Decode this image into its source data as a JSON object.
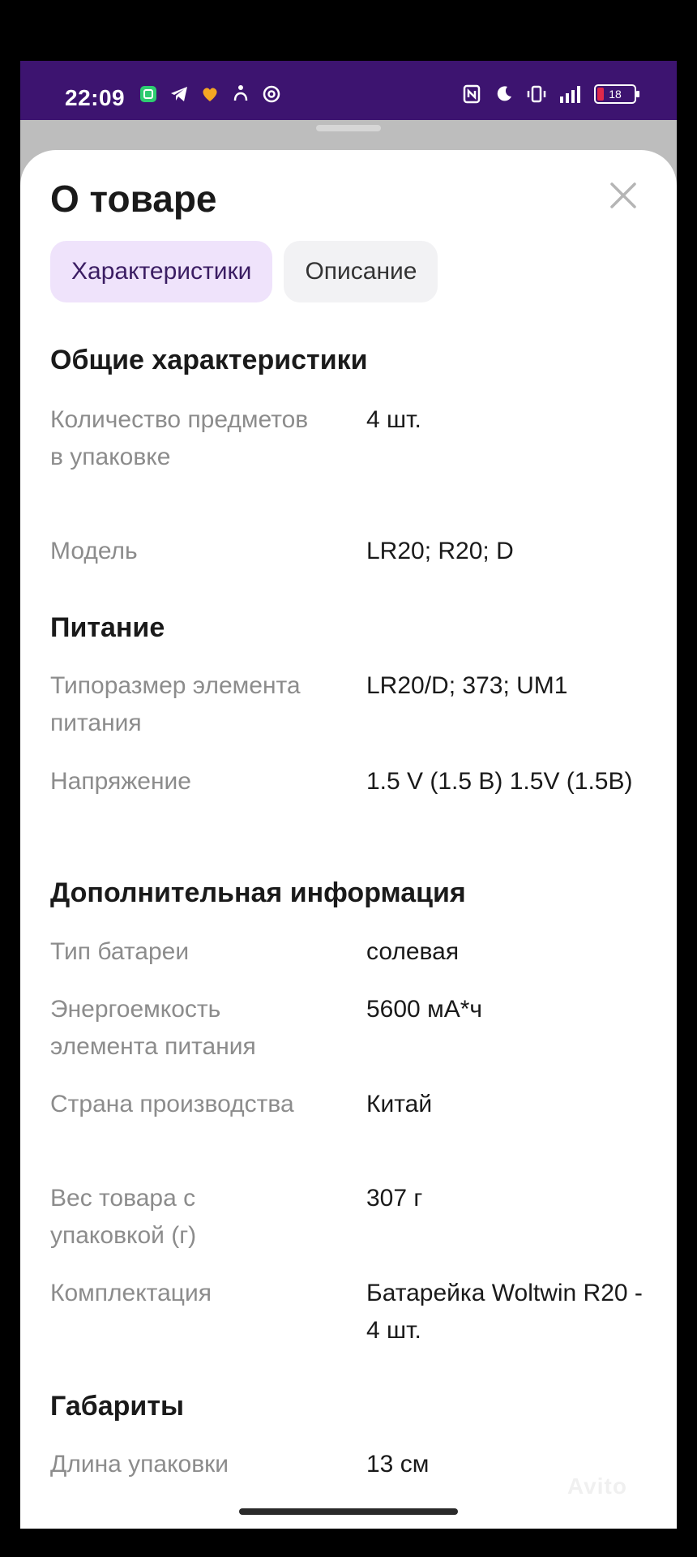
{
  "status_bar": {
    "time": "22:09",
    "battery": "18",
    "left_icons": [
      "notes-app-icon",
      "telegram-icon",
      "dating-app-icon",
      "accessibility-icon",
      "at-icon"
    ],
    "right_icons": [
      "nfc-icon",
      "moon-icon",
      "vibrate-icon",
      "signal-icon"
    ]
  },
  "sheet": {
    "title": "О товаре",
    "close_icon": "close-icon",
    "tabs": [
      {
        "label": "Характеристики",
        "active": true
      },
      {
        "label": "Описание",
        "active": false
      }
    ]
  },
  "sections": [
    {
      "title": "Общие характеристики",
      "rows": [
        {
          "label": "Количество предметов в упаковке",
          "value": "4 шт."
        },
        {
          "label": "Модель",
          "value": "LR20; R20; D"
        }
      ]
    },
    {
      "title": "Питание",
      "rows": [
        {
          "label": "Типоразмер элемента питания",
          "value": "LR20/D; 373; UM1"
        },
        {
          "label": "Напряжение",
          "value": "1.5 V (1.5 В) 1.5V (1.5В)"
        }
      ]
    },
    {
      "title": "Дополнительная информация",
      "rows": [
        {
          "label": "Тип батареи",
          "value": "солевая"
        },
        {
          "label": "Энергоемкость элемента питания",
          "value": "5600 мА*ч"
        },
        {
          "label": "Страна производства",
          "value": "Китай"
        },
        {
          "label": "Вес товара с упаковкой (г)",
          "value": "307 г"
        },
        {
          "label": "Комплектация",
          "value": "Батарейка Woltwin R20 - 4 шт."
        }
      ]
    },
    {
      "title": "Габариты",
      "rows": [
        {
          "label": "Длина упаковки",
          "value": "13 см"
        }
      ]
    }
  ],
  "watermark": "Avito",
  "colors": {
    "status_bar": "#3d1470",
    "active_tab_bg": "#efe3fb",
    "inactive_tab_bg": "#f2f2f4",
    "label_text": "#8c8c8c"
  }
}
